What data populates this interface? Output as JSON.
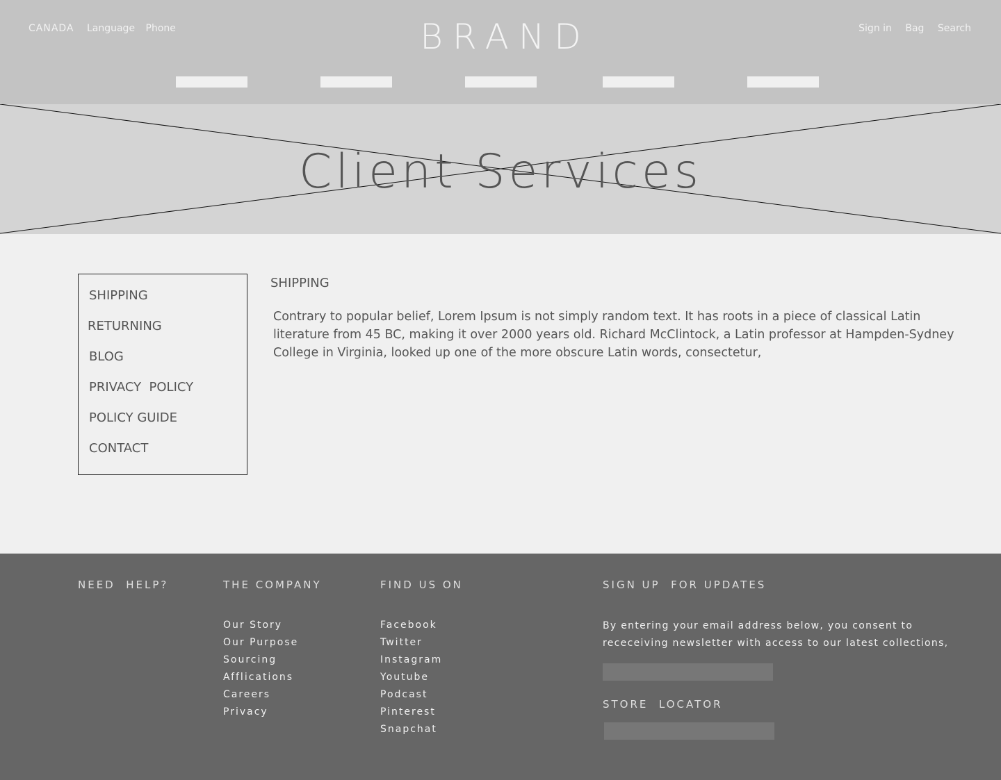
{
  "header": {
    "country": "CANADA",
    "language": "Language",
    "phone": "Phone",
    "brand": "BRAND",
    "sign_in": "Sign in",
    "bag": "Bag",
    "search": "Search"
  },
  "hero": {
    "title": "Client Services"
  },
  "sidebar": {
    "items": [
      {
        "label": "SHIPPING"
      },
      {
        "label": "RETURNING"
      },
      {
        "label": "BLOG"
      },
      {
        "label": "PRIVACY  POLICY"
      },
      {
        "label": "POLICY GUIDE"
      },
      {
        "label": "CONTACT"
      }
    ]
  },
  "content": {
    "heading": "SHIPPING",
    "body": "Contrary to popular belief,  Lorem  Ipsum is not simply random text.  It has roots in a piece of classical  Latin literature from 45  BC, making it over 2000 years old.  Richard  McClintock, a  Latin professor at  Hampden-Sydney College in Virginia, looked up one of the more obscure  Latin words, consectetur,"
  },
  "footer": {
    "need_help": "NEED  HELP?",
    "company": {
      "heading": "THE COMPANY",
      "links": [
        "Our Story",
        "Our Purpose",
        "Sourcing",
        "Afflications",
        "Careers",
        "Privacy"
      ]
    },
    "find_us": {
      "heading": "FIND US ON",
      "links": [
        "Facebook",
        "Twitter",
        "Instagram",
        "Youtube",
        "Podcast",
        "Pinterest",
        "Snapchat"
      ]
    },
    "signup": {
      "heading": "SIGN UP  FOR UPDATES",
      "text": "By entering your email address below, you consent to receceiving newsletter with access to our latest collections,",
      "email_value": ""
    },
    "store_locator": {
      "heading": "STORE  LOCATOR",
      "value": ""
    }
  }
}
